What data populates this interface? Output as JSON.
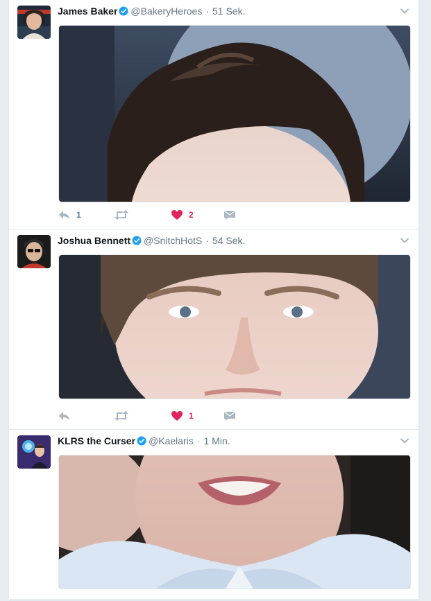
{
  "tweets": [
    {
      "fullname": "James Baker",
      "username": "@BakeryHeroes",
      "separator": "·",
      "time": "51 Sek.",
      "reply_count": "1",
      "retweet_count": "",
      "like_count": "2"
    },
    {
      "fullname": "Joshua Bennett",
      "username": "@SnitchHotS",
      "separator": "·",
      "time": "54 Sek.",
      "reply_count": "",
      "retweet_count": "",
      "like_count": "1"
    },
    {
      "fullname": "KLRS the Curser",
      "username": "@Kaelaris",
      "separator": "·",
      "time": "1 Min."
    }
  ],
  "colors": {
    "verified_blue": "#1da1f2",
    "like_red": "#e0245e",
    "meta_gray": "#657786",
    "icon_gray": "#aab8c2",
    "background": "#e6ecf0"
  },
  "icons": {
    "verified": "verified-badge-icon",
    "caret": "chevron-down-icon",
    "reply": "reply-icon",
    "retweet": "retweet-icon",
    "like": "heart-icon",
    "dm": "direct-message-icon"
  }
}
